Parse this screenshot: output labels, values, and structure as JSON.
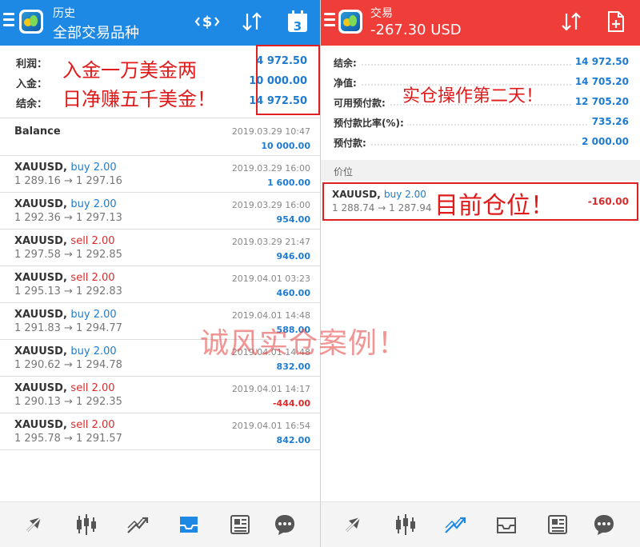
{
  "left": {
    "appbar": {
      "title": "历史",
      "subtitle": "全部交易品种",
      "calendar_day": "3"
    },
    "summary": [
      {
        "label": "利润：",
        "value": "4 972.50"
      },
      {
        "label": "入金：",
        "value": "10 000.00"
      },
      {
        "label": "结余：",
        "value": "14 972.50"
      }
    ],
    "balance_row": {
      "label": "Balance",
      "time": "2019.03.29 10:47",
      "amount": "10 000.00"
    },
    "trades": [
      {
        "symbol": "XAUUSD,",
        "side": "buy 2.00",
        "prices": "1 289.16 → 1 297.16",
        "time": "2019.03.29 16:00",
        "profit": "1 600.00"
      },
      {
        "symbol": "XAUUSD,",
        "side": "buy 2.00",
        "prices": "1 292.36 → 1 297.13",
        "time": "2019.03.29 16:00",
        "profit": "954.00"
      },
      {
        "symbol": "XAUUSD,",
        "side": "sell 2.00",
        "prices": "1 297.58 → 1 292.85",
        "time": "2019.03.29 21:47",
        "profit": "946.00"
      },
      {
        "symbol": "XAUUSD,",
        "side": "sell 2.00",
        "prices": "1 295.13 → 1 292.83",
        "time": "2019.04.01 03:23",
        "profit": "460.00"
      },
      {
        "symbol": "XAUUSD,",
        "side": "buy 2.00",
        "prices": "1 291.83 → 1 294.77",
        "time": "2019.04.01 14:48",
        "profit": "588.00"
      },
      {
        "symbol": "XAUUSD,",
        "side": "buy 2.00",
        "prices": "1 290.62 → 1 294.78",
        "time": "2019.04.01 14:48",
        "profit": "832.00"
      },
      {
        "symbol": "XAUUSD,",
        "side": "sell 2.00",
        "prices": "1 290.13 → 1 292.35",
        "time": "2019.04.01 14:17",
        "profit": "-444.00"
      },
      {
        "symbol": "XAUUSD,",
        "side": "sell 2.00",
        "prices": "1 295.78 → 1 291.57",
        "time": "2019.04.01 16:54",
        "profit": "842.00"
      }
    ],
    "annotation": {
      "line1": "入金一万美金两",
      "line2": "日净赚五千美金！"
    }
  },
  "right": {
    "appbar": {
      "title": "交易",
      "subtitle": "-267.30 USD"
    },
    "account": [
      {
        "label": "结余:",
        "value": "14 972.50"
      },
      {
        "label": "净值:",
        "value": "14 705.20"
      },
      {
        "label": "可用预付款:",
        "value": "12 705.20"
      },
      {
        "label": "预付款比率(%):",
        "value": "735.26"
      },
      {
        "label": "预付款:",
        "value": "2 000.00"
      }
    ],
    "section_label": "价位",
    "position": {
      "symbol": "XAUUSD,",
      "side": "buy 2.00",
      "prices": "1 288.74 → 1 287.94",
      "profit": "-160.00"
    },
    "annotation_top": "实仓操作第二天！",
    "annotation_position": "目前仓位！"
  },
  "watermark": "诚风实仓案例！",
  "colors": {
    "left_bar": "#1e88e5",
    "right_bar": "#ef3e3a",
    "profit_blue": "#1e7bd0",
    "loss_red": "#d92c2c",
    "annotation_red": "#e01a1a"
  },
  "nav_icons": [
    "quotes-icon",
    "chart-icon",
    "trade-icon",
    "history-icon",
    "news-icon",
    "chat-icon"
  ]
}
